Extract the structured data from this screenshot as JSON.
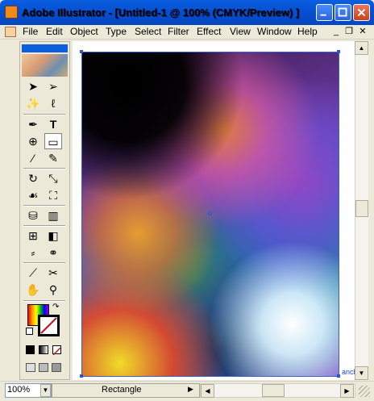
{
  "window": {
    "title": "Adobe Illustrator - [Untitled-1 @ 100% (CMYK/Preview) ]"
  },
  "menu": {
    "items": [
      "File",
      "Edit",
      "Object",
      "Type",
      "Select",
      "Filter",
      "Effect",
      "View",
      "Window",
      "Help"
    ]
  },
  "tools": {
    "icons": [
      "selection-tool-icon",
      "direct-selection-tool-icon",
      "magic-wand-tool-icon",
      "lasso-tool-icon",
      "pen-tool-icon",
      "type-tool-icon",
      "polar-grid-tool-icon",
      "rectangle-tool-icon",
      "paintbrush-tool-icon",
      "pencil-tool-icon",
      "rotate-tool-icon",
      "scale-tool-icon",
      "warp-tool-icon",
      "free-transform-tool-icon",
      "symbol-sprayer-tool-icon",
      "column-graph-tool-icon",
      "mesh-tool-icon",
      "gradient-tool-icon",
      "eyedropper-tool-icon",
      "blend-tool-icon",
      "slice-tool-icon",
      "scissors-tool-icon",
      "hand-tool-icon",
      "zoom-tool-icon"
    ]
  },
  "canvas": {
    "anchor_label": "anch"
  },
  "status": {
    "zoom": "100%",
    "tool": "Rectangle"
  },
  "colors": {
    "title_bar": "#0A5FE0",
    "selection_outline": "#2B55D6",
    "fill_swatch_accent": "#3B5FD0",
    "stroke_indicator": "#C0121E"
  }
}
